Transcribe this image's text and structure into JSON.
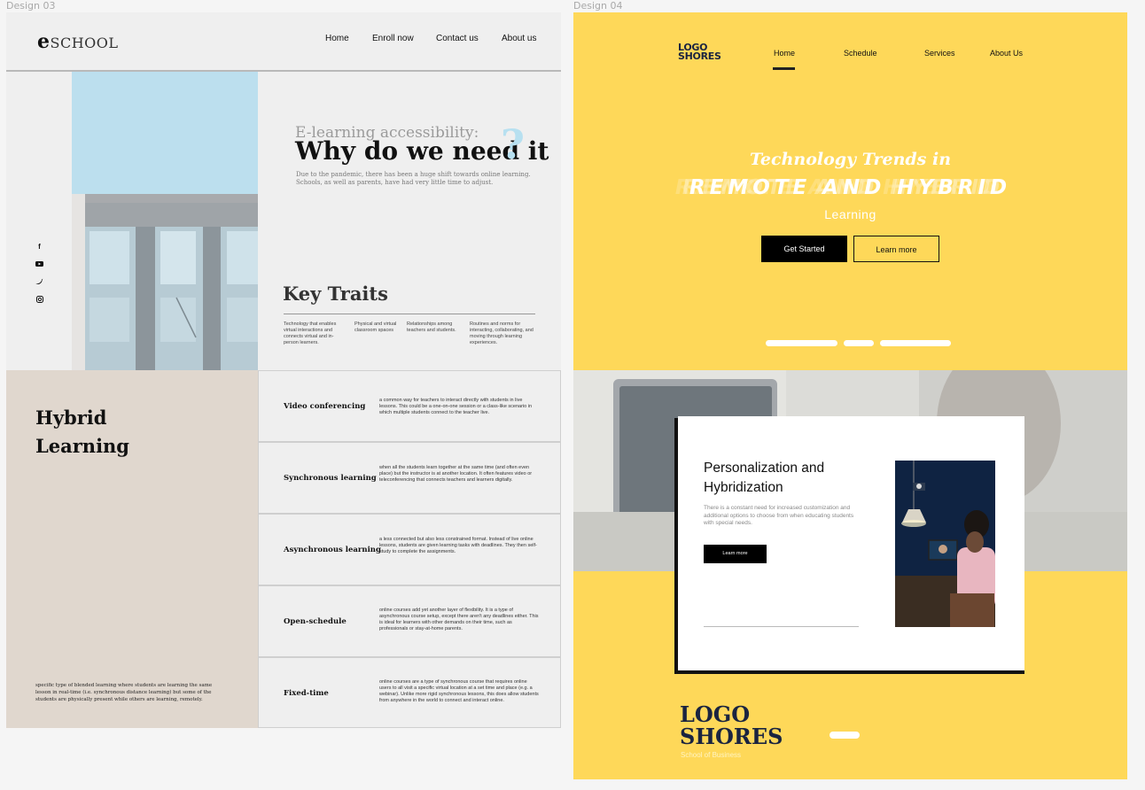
{
  "canvas": {
    "labels": [
      "Design 03",
      "Design 04"
    ]
  },
  "design03": {
    "logo_e": "e",
    "logo_rest": "SCHOOL",
    "nav": [
      "Home",
      "Enroll now",
      "Contact us",
      "About us"
    ],
    "socials": [
      "facebook-icon",
      "youtube-icon",
      "twitter-icon",
      "instagram-icon"
    ],
    "kicker": "E-learning accessibility:",
    "headline": "Why do we need it",
    "qmark": "?",
    "intro": "Due to the pandemic, there has been a huge shift towards online learning. Schools, as well as parents, have had very little time to adjust.",
    "traits_title": "Key Traits",
    "traits": [
      "Technology that enables virtual interactions and connects virtual and in-person learners.",
      "Physical and virtual classroom spaces",
      "Relationships among teachers and students.",
      "Routines and norms for interacting, collaborating, and moving through learning experiences."
    ],
    "hybrid_title": "Hybrid Learning",
    "hybrid_text": "specific type of blended learning where students are learning the same lesson in real-time (i.e. synchronous distance learning) but some of the students are physically present while others are learning, remotely.",
    "rows": [
      {
        "label": "Video conferencing",
        "desc": "a common way for teachers to interact directly with students in live lessons. This could be a one-on-one session or a class-like scenario in which multiple students connect to the teacher live."
      },
      {
        "label": "Synchronous learning",
        "desc": "when all the students learn together at the same time (and often even place) but the instructor is at another location. It often features video or teleconferencing that connects teachers and learners digitally."
      },
      {
        "label": "Asynchronous learning",
        "desc": "a less connected but also less constrained format. Instead of live online lessons, students are given learning tasks with deadlines. They then self-study to complete the assignments."
      },
      {
        "label": "Open-schedule",
        "desc": "online courses add yet another layer of flexibility. It is a type of asynchronous course setup, except there aren't any deadlines either. This is ideal for learners with other demands on their time, such as professionals or stay-at-home parents."
      },
      {
        "label": "Fixed-time",
        "desc": "online courses are a type of synchronous course that requires online users to all visit a specific virtual location at a set time and place (e.g. a webinar). Unlike more rigid synchronous lessons, this does allow students from anywhere in the world to connect and interact online."
      }
    ]
  },
  "design04": {
    "logo_line1": "LOGO",
    "logo_line2": "SHORES",
    "nav": [
      "Home",
      "Schedule",
      "Services",
      "About Us"
    ],
    "active_nav": "Home",
    "hero_line1": "Technology Trends in",
    "hero_line2": "REMOTE AND HYBRID",
    "hero_line3": "Learning",
    "btn_primary": "Get Started",
    "btn_secondary": "Learn more",
    "card_title": "Personalization and Hybridization",
    "card_text": "There is a constant need for increased customization and additional options to choose from when educating students with special needs.",
    "card_button": "Learn more",
    "footer_logo_line1": "LOGO",
    "footer_logo_line2": "SHORES",
    "footer_tagline": "School of Business",
    "colors": {
      "brand_yellow": "#fed859",
      "navy": "#1a2440"
    }
  }
}
